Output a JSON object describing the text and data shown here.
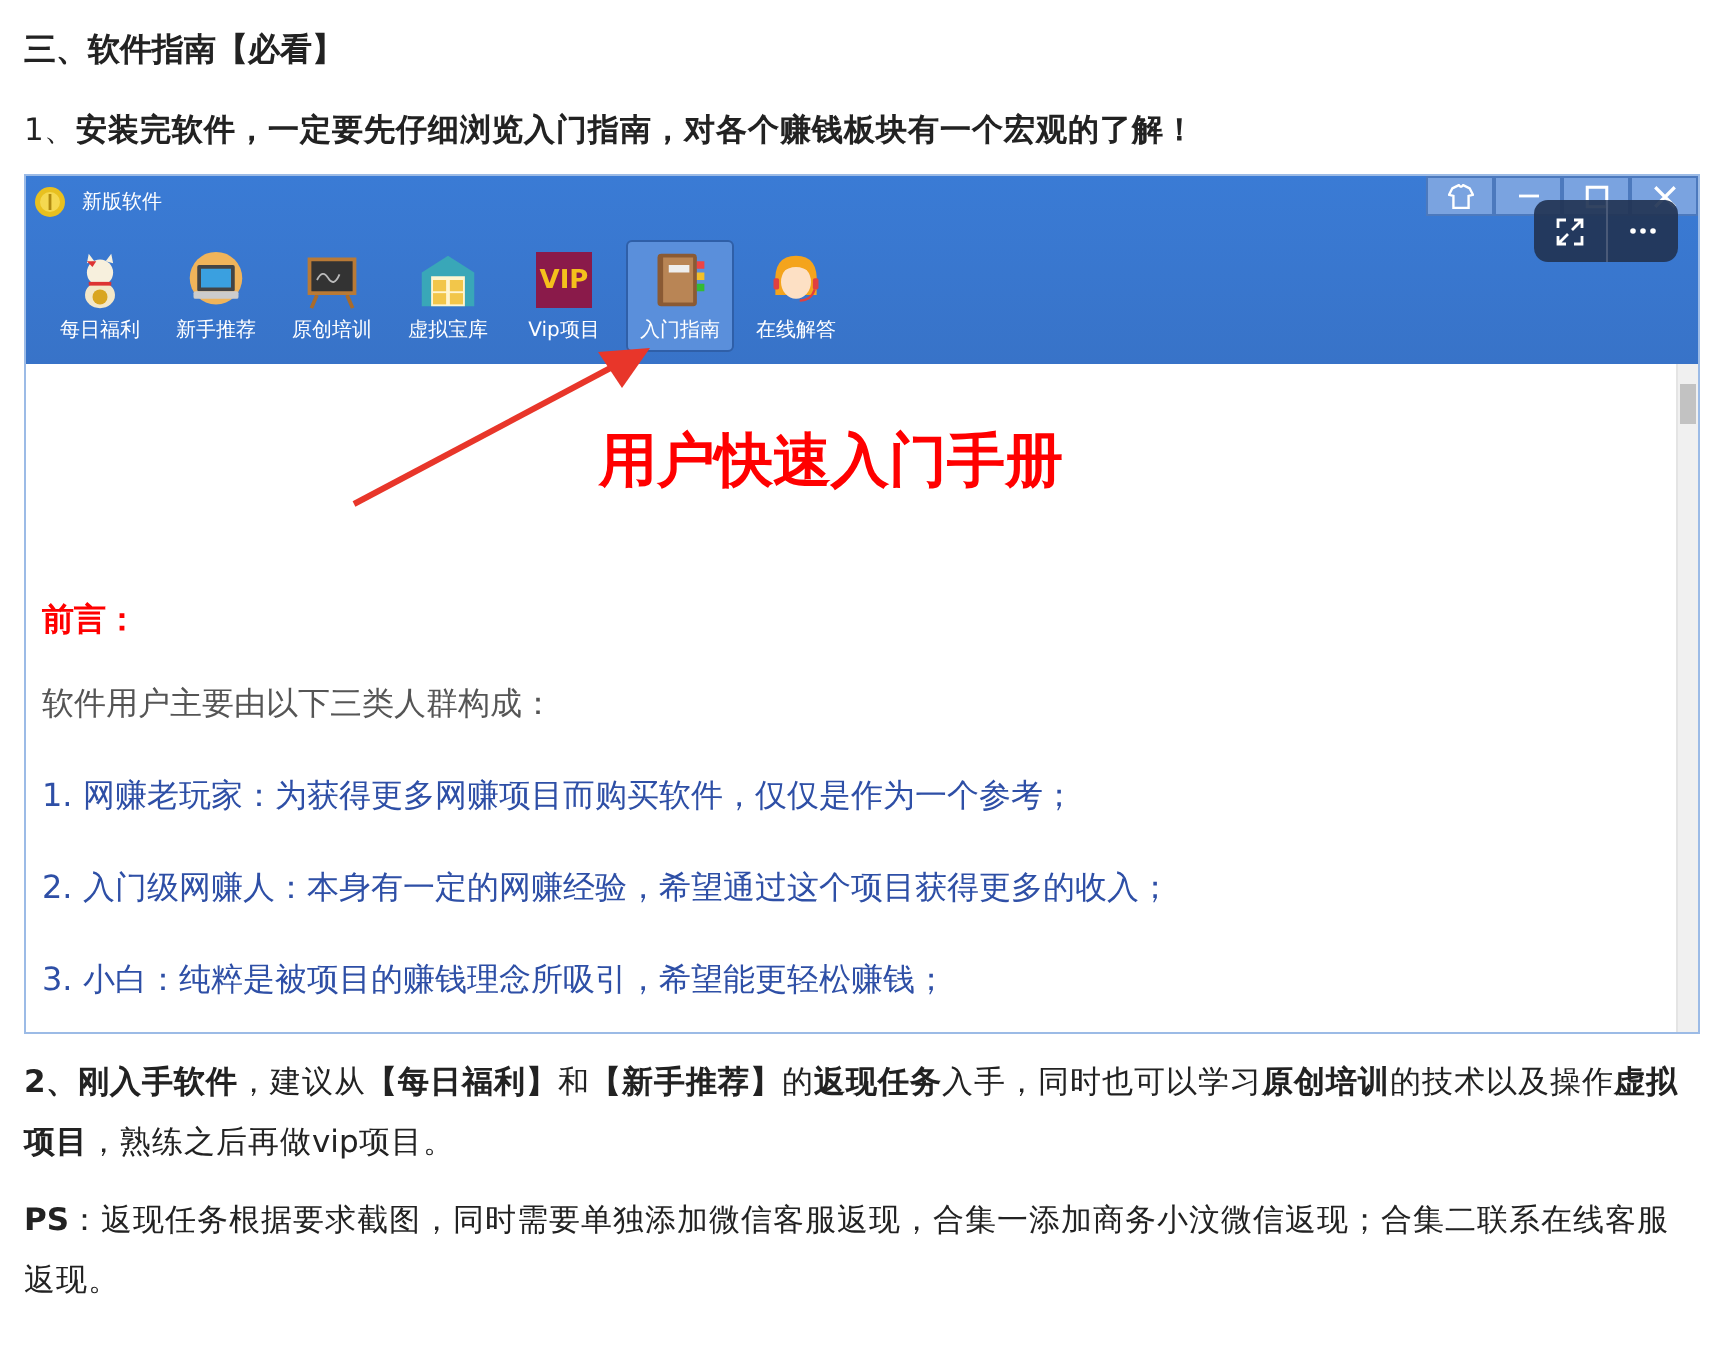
{
  "heading": "三、软件指南【必看】",
  "step1": "1、**安装完软件，一定要先仔细浏览入门指南，对各个赚钱板块有一个宏观的了解！**",
  "screenshot": {
    "window": {
      "title": "新版软件",
      "controls": [
        {
          "kind": "skin"
        },
        {
          "kind": "minimize"
        },
        {
          "kind": "maximize"
        },
        {
          "kind": "close"
        }
      ]
    },
    "toolbar": [
      {
        "label": "每日福利",
        "kind": "cat",
        "selected": false
      },
      {
        "label": "新手推荐",
        "kind": "laptop",
        "selected": false
      },
      {
        "label": "原创培训",
        "kind": "chalkboard",
        "selected": false
      },
      {
        "label": "虚拟宝库",
        "kind": "warehouse",
        "selected": false
      },
      {
        "label": "Vip项目",
        "kind": "vip",
        "badge": "VIP",
        "selected": false
      },
      {
        "label": "入门指南",
        "kind": "book",
        "selected": true
      },
      {
        "label": "在线解答",
        "kind": "agent",
        "selected": false
      }
    ],
    "document": {
      "title": "用户快速入门手册",
      "preface_label": "前言：",
      "intro": "软件用户主要由以下三类人群构成：",
      "items": [
        "1. 网赚老玩家：为获得更多网赚项目而购买软件，仅仅是作为一个参考；",
        "2. 入门级网赚人：本身有一定的网赚经验，希望通过这个项目获得更多的收入；",
        "3. 小白：纯粹是被项目的赚钱理念所吸引，希望能更轻松赚钱；"
      ]
    }
  },
  "viewer_controls": [
    {
      "kind": "expand"
    },
    {
      "kind": "more"
    }
  ],
  "paragraphs": [
    "**2、刚入手软件**，建议从**【每日福利】**和**【新手推荐】**的**返现任务**入手，同时也可以学习**原创培训**的技术以及操作**虚拟项目**，熟练之后再做vip项目。",
    "**PS**：返现任务根据要求截图，同时需要单独添加微信客服返现，合集一添加商务小汶微信返现；合集二联系在线客服返现。"
  ]
}
